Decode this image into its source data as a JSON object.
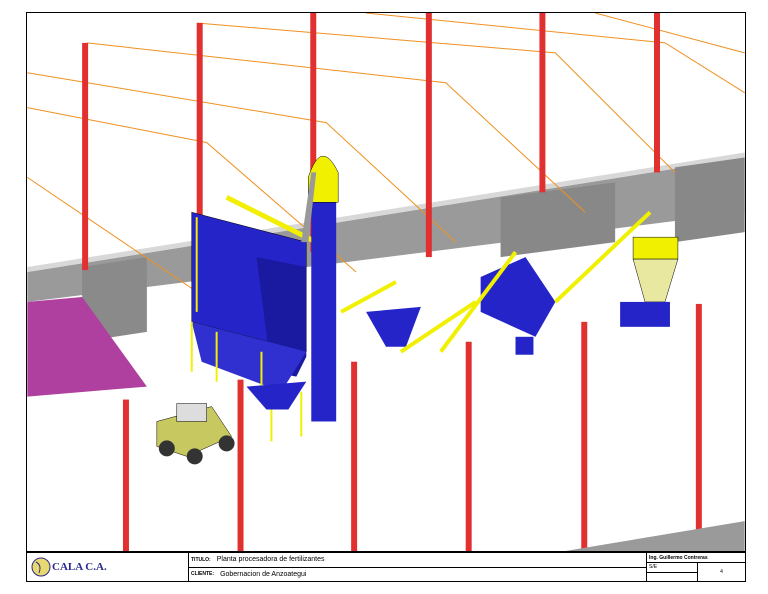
{
  "drawing": {
    "title_label": "TITULO:",
    "title": "Planta procesadora de fertilizantes",
    "client_label": "CLIENTE:",
    "client": "Gobernacion de Anzoategui",
    "designer": "Ing. Guillermo Contreras",
    "scale": "S/E",
    "sheet": "4",
    "logo": "CALA C.A."
  },
  "colors": {
    "equipment": "#2424c8",
    "structure": "#f0f000",
    "columns": "#e03030",
    "wall": "#9a9a9a",
    "pit": "#b040a0",
    "lines": "#f09020"
  }
}
